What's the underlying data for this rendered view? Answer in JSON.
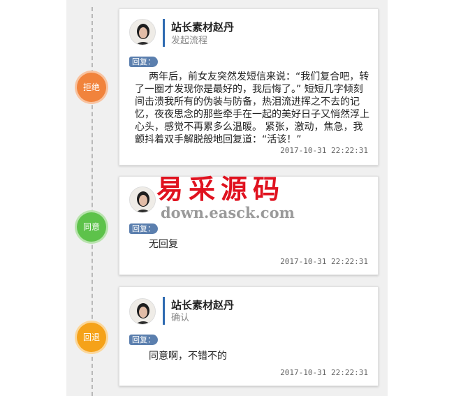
{
  "items": [
    {
      "status": "拒绝",
      "status_color": "#f1833c",
      "user_name": "站长素材赵丹",
      "action": "发起流程",
      "reply_label": "回复：",
      "text": "两年后，前女友突然发短信来说：“我们复合吧，转了一圈才发现你是最好的，我后悔了。” 短短几字倾刻间击溃我所有的伪装与防备，热泪流进挥之不去的记忆，夜夜思念的那些牵手在一起的美好日子又悄然浮上心头，感觉不再累多么温暖。 紧张，激动，焦急，我颤抖着双手解脱般地回复道：“活该！”",
      "time": "2017-10-31 22:22:31"
    },
    {
      "status": "同意",
      "status_color": "#5dc24a",
      "user_name": "",
      "action": "",
      "reply_label": "回复：",
      "text": "无回复",
      "time": "2017-10-31 22:22:31"
    },
    {
      "status": "回退",
      "status_color": "#f5a219",
      "user_name": "站长素材赵丹",
      "action": "确认",
      "reply_label": "回复：",
      "text": "同意啊，不错不的",
      "time": "2017-10-31 22:22:31"
    }
  ],
  "watermark": {
    "title": "易采源码",
    "url": "down.easck.com"
  }
}
